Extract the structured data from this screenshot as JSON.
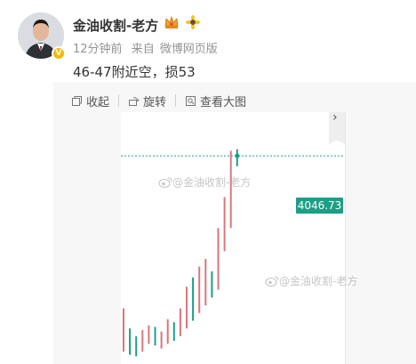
{
  "post": {
    "author": "金油收割-老方",
    "time": "12分钟前",
    "source_prefix": "来自",
    "source": "微博网页版",
    "text": "46-47附近空，损53"
  },
  "toolbar": {
    "collect": "收起",
    "rotate": "旋转",
    "view_large": "查看大图"
  },
  "chart": {
    "price_label": "4046.73",
    "watermark": "@金油收割-老方"
  },
  "colors": {
    "up": "#d9767d",
    "down": "#1e9e86",
    "accent": "#1e9e86"
  },
  "chart_data": {
    "type": "candlestick",
    "current_price": 4046.73,
    "candles_approx_high_low": [
      {
        "dir": "up",
        "low": 3920,
        "high": 3948
      },
      {
        "dir": "down",
        "low": 3918,
        "high": 3935
      },
      {
        "dir": "down",
        "low": 3917,
        "high": 3930
      },
      {
        "dir": "up",
        "low": 3920,
        "high": 3934
      },
      {
        "dir": "up",
        "low": 3925,
        "high": 3937
      },
      {
        "dir": "down",
        "low": 3924,
        "high": 3936
      },
      {
        "dir": "up",
        "low": 3922,
        "high": 3933
      },
      {
        "dir": "up",
        "low": 3925,
        "high": 3941
      },
      {
        "dir": "down",
        "low": 3927,
        "high": 3939
      },
      {
        "dir": "up",
        "low": 3930,
        "high": 3948
      },
      {
        "dir": "up",
        "low": 3935,
        "high": 3962
      },
      {
        "dir": "down",
        "low": 3940,
        "high": 3968
      },
      {
        "dir": "up",
        "low": 3945,
        "high": 3975
      },
      {
        "dir": "up",
        "low": 3950,
        "high": 3980
      },
      {
        "dir": "down",
        "low": 3955,
        "high": 3972
      },
      {
        "dir": "up",
        "low": 3960,
        "high": 4000
      },
      {
        "dir": "up",
        "low": 3985,
        "high": 4020
      },
      {
        "dir": "up",
        "low": 4000,
        "high": 4050
      },
      {
        "dir": "down",
        "low": 4040,
        "high": 4051
      }
    ]
  }
}
